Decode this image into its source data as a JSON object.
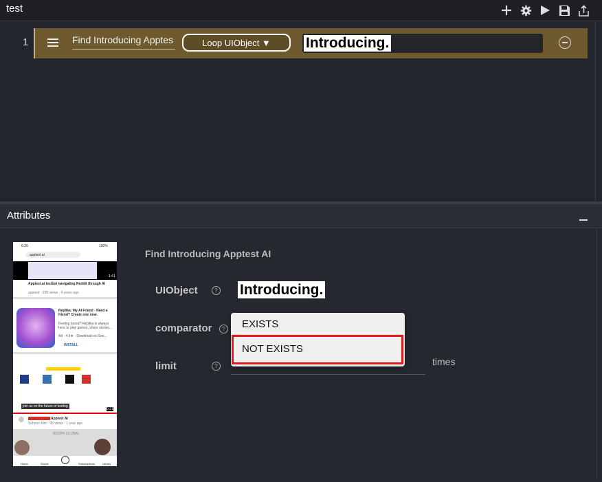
{
  "app": {
    "title": "test"
  },
  "toolbar": {
    "icons": [
      "plus-icon",
      "gear-icon",
      "play-icon",
      "save-icon",
      "export-icon"
    ]
  },
  "editor": {
    "line_number": "1",
    "step": {
      "name": "Find Introducing Apptes",
      "action_label": "Loop UIObject ▼",
      "uiobject_text": "Introducing."
    }
  },
  "attributes": {
    "title": "Attributes",
    "section_title": "Find Introducing Apptest AI",
    "fields": {
      "uiobject_label": "UIObject",
      "uiobject_value": "Introducing.",
      "comparator_label": "comparator",
      "limit_label": "limit",
      "limit_unit": "times"
    },
    "help_glyph": "?",
    "comparator_options": [
      "EXISTS",
      "NOT EXISTS"
    ],
    "highlighted_option": "NOT EXISTS"
  },
  "phone_screenshot": {
    "status_time": "6:26",
    "battery": "100%",
    "search_query": "apptest ai",
    "video_duration_1": "1:41",
    "item1_title": "Apptest.ai testbot navigating Reddit through AI",
    "item1_meta": "apptest · 298 views · 4 years ago",
    "ad_title": "Replika: My AI Friend - Need a friend? Create one now.",
    "ad_desc": "Feeling bored? Replika is always here to play games, share stories...",
    "ad_meta": "Ad · 4.5★ · Download on Goo...",
    "ad_cta": "INSTALL",
    "caption": "join us on the future of testing",
    "video_duration_2": "0:21",
    "channel_name": "Apptest AI",
    "channel_meta": "Sohyun Kim · 95 views · 1 year ago",
    "banner_text": "BEOPH GLOBAL",
    "nav_items": [
      "Home",
      "Shorts",
      "",
      "Subscriptions",
      "Library"
    ]
  }
}
